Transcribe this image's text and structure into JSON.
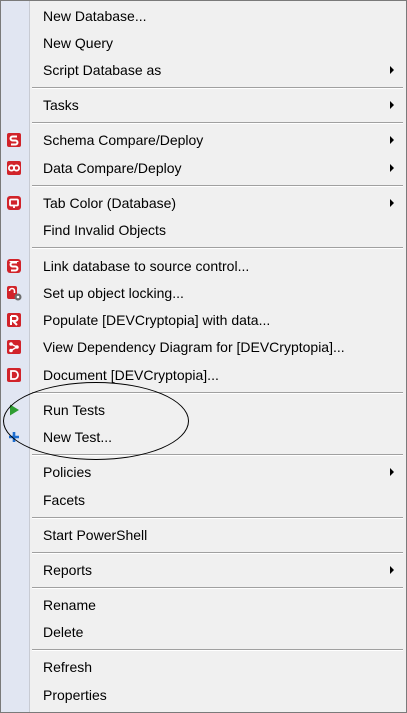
{
  "menu": {
    "items": {
      "new_database": "New Database...",
      "new_query": "New Query",
      "script_database_as": "Script Database as",
      "tasks": "Tasks",
      "schema_compare": "Schema Compare/Deploy",
      "data_compare": "Data Compare/Deploy",
      "tab_color": "Tab Color (Database)",
      "find_invalid": "Find Invalid Objects",
      "link_source_control": "Link database to source control...",
      "object_locking": "Set up object locking...",
      "populate": "Populate [DEVCryptopia] with data...",
      "dependency_diagram": "View Dependency Diagram for [DEVCryptopia]...",
      "document": "Document [DEVCryptopia]...",
      "run_tests": "Run Tests",
      "new_test": "New Test...",
      "policies": "Policies",
      "facets": "Facets",
      "start_powershell": "Start PowerShell",
      "reports": "Reports",
      "rename": "Rename",
      "delete": "Delete",
      "refresh": "Refresh",
      "properties": "Properties"
    }
  },
  "icons": {
    "schema_compare": "schema-compare-icon",
    "data_compare": "data-compare-icon",
    "tab_color": "tab-color-icon",
    "link_source_control": "source-control-icon",
    "object_locking": "object-lock-icon",
    "populate": "data-generator-icon",
    "dependency_diagram": "dependency-tracker-icon",
    "document": "doc-icon",
    "run_tests": "play-icon",
    "new_test": "plus-icon"
  },
  "colors": {
    "redgate_red": "#d1232a",
    "play_green": "#2e9d32",
    "plus_blue": "#1f6fd1",
    "gutter": "#e1e6f2",
    "menu_bg": "#f0f0f0"
  }
}
